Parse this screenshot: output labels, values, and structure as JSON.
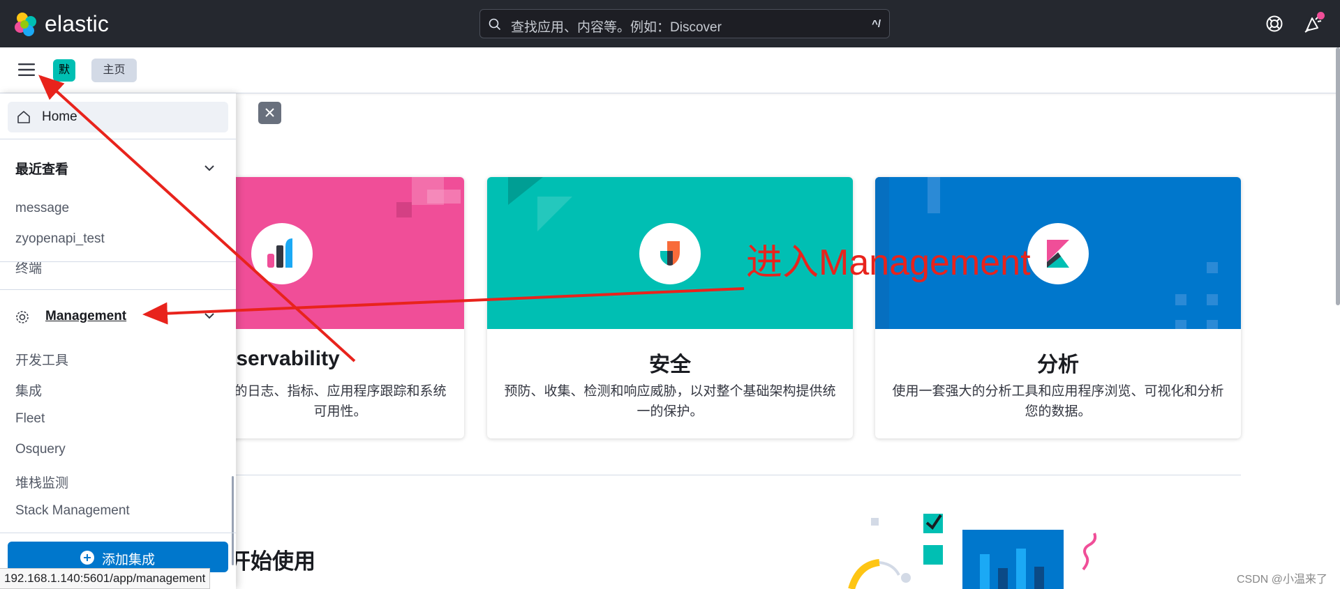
{
  "header": {
    "brand": "elastic",
    "search_placeholder": "查找应用、内容等。例如：Discover",
    "search_shortcut": "^/",
    "icons": [
      "help-icon",
      "newsfeed-icon"
    ]
  },
  "subbar": {
    "space_badge": "默",
    "breadcrumb": "主页"
  },
  "sidenav": {
    "home_label": "Home",
    "recent_title": "最近查看",
    "recent_items": [
      "message",
      "zyopenapi_test",
      "终端"
    ],
    "management_title": "Management",
    "management_items": [
      "开发工具",
      "集成",
      "Fleet",
      "Osquery",
      "堆栈监测",
      "Stack Management"
    ],
    "add_integration_label": "添加集成"
  },
  "cards": [
    {
      "title": "Observability",
      "desc": "整合您的日志、指标、应用程序跟踪和系统可用性。",
      "color": "#f04e98"
    },
    {
      "title": "安全",
      "desc": "预防、收集、检测和响应威胁，以对整个基础架构提供统一的保护。",
      "color": "#00bfb3"
    },
    {
      "title": "分析",
      "desc": "使用一套强大的分析工具和应用程序浏览、可视化和分析您的数据。",
      "color": "#0077cc"
    }
  ],
  "cards_visible": [
    {
      "title": "bservability",
      "desc_line1": "的日志、指标、应用程序跟踪和系统",
      "desc_line2": "可用性。"
    },
    {
      "title": "安全",
      "desc_line1": "预防、收集、检测和响应威胁，以对整个基础架构提供统",
      "desc_line2": "一的保护。"
    },
    {
      "title": "分析",
      "desc_line1": "使用一套强大的分析工具和应用程序浏览、可视化和分析",
      "desc_line2": "您的数据。"
    }
  ],
  "get_started": "开始使用",
  "status_url": "192.168.1.140:5601/app/management",
  "watermark": "CSDN @小温来了",
  "annotation": {
    "text": "进入Management",
    "color": "#e8231c"
  }
}
